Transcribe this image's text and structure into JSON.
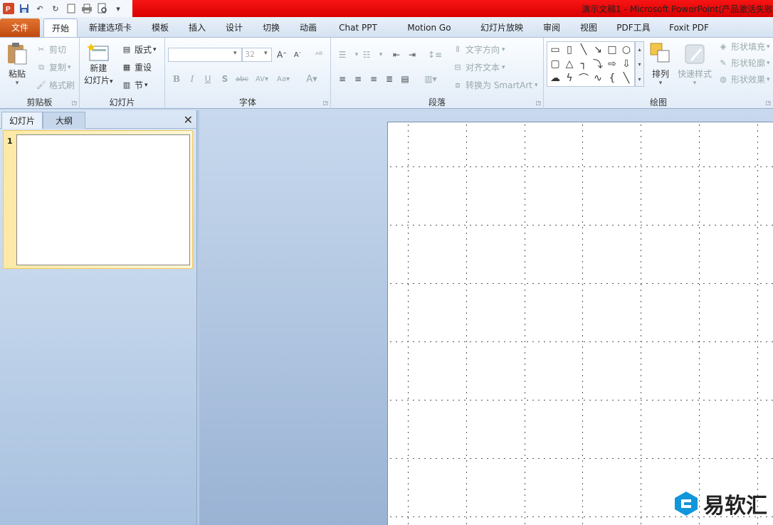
{
  "window": {
    "title": "演示文稿1 - Microsoft PowerPoint(产品激活失败"
  },
  "quick_access": [
    "save-icon",
    "undo-icon",
    "redo-icon",
    "new-icon",
    "print-icon",
    "preview-icon",
    "customize-icon"
  ],
  "tabs": [
    {
      "label": "文件"
    },
    {
      "label": "开始"
    },
    {
      "label": "新建选项卡"
    },
    {
      "label": "模板"
    },
    {
      "label": "插入"
    },
    {
      "label": "设计"
    },
    {
      "label": "切换"
    },
    {
      "label": "动画"
    },
    {
      "label": "Chat PPT"
    },
    {
      "label": "Motion Go"
    },
    {
      "label": "幻灯片放映"
    },
    {
      "label": "审阅"
    },
    {
      "label": "视图"
    },
    {
      "label": "PDF工具"
    },
    {
      "label": "Foxit PDF"
    }
  ],
  "ribbon": {
    "clipboard": {
      "label": "剪贴板",
      "paste": "粘贴",
      "cut": "剪切",
      "copy": "复制",
      "format_painter": "格式刷"
    },
    "slides": {
      "label": "幻灯片",
      "new_slide_1": "新建",
      "new_slide_2": "幻灯片",
      "layout": "版式",
      "reset": "重设",
      "section": "节"
    },
    "font": {
      "label": "字体",
      "font_name": "",
      "font_size": "32"
    },
    "paragraph": {
      "label": "段落",
      "text_direction": "文字方向",
      "align_text": "对齐文本",
      "smartart": "转换为 SmartArt"
    },
    "drawing": {
      "label": "绘图",
      "arrange": "排列",
      "quick_styles": "快速样式",
      "shape_fill": "形状填充",
      "shape_outline": "形状轮廓",
      "shape_effects": "形状效果"
    }
  },
  "panel": {
    "tabs": [
      {
        "label": "幻灯片"
      },
      {
        "label": "大纲"
      }
    ],
    "slide_number": "1"
  },
  "watermark": {
    "text": "易软汇"
  },
  "colors": {
    "titlebar_red": "#e60000",
    "file_tab": "#d35a1e",
    "accent_blue": "#1296db"
  }
}
